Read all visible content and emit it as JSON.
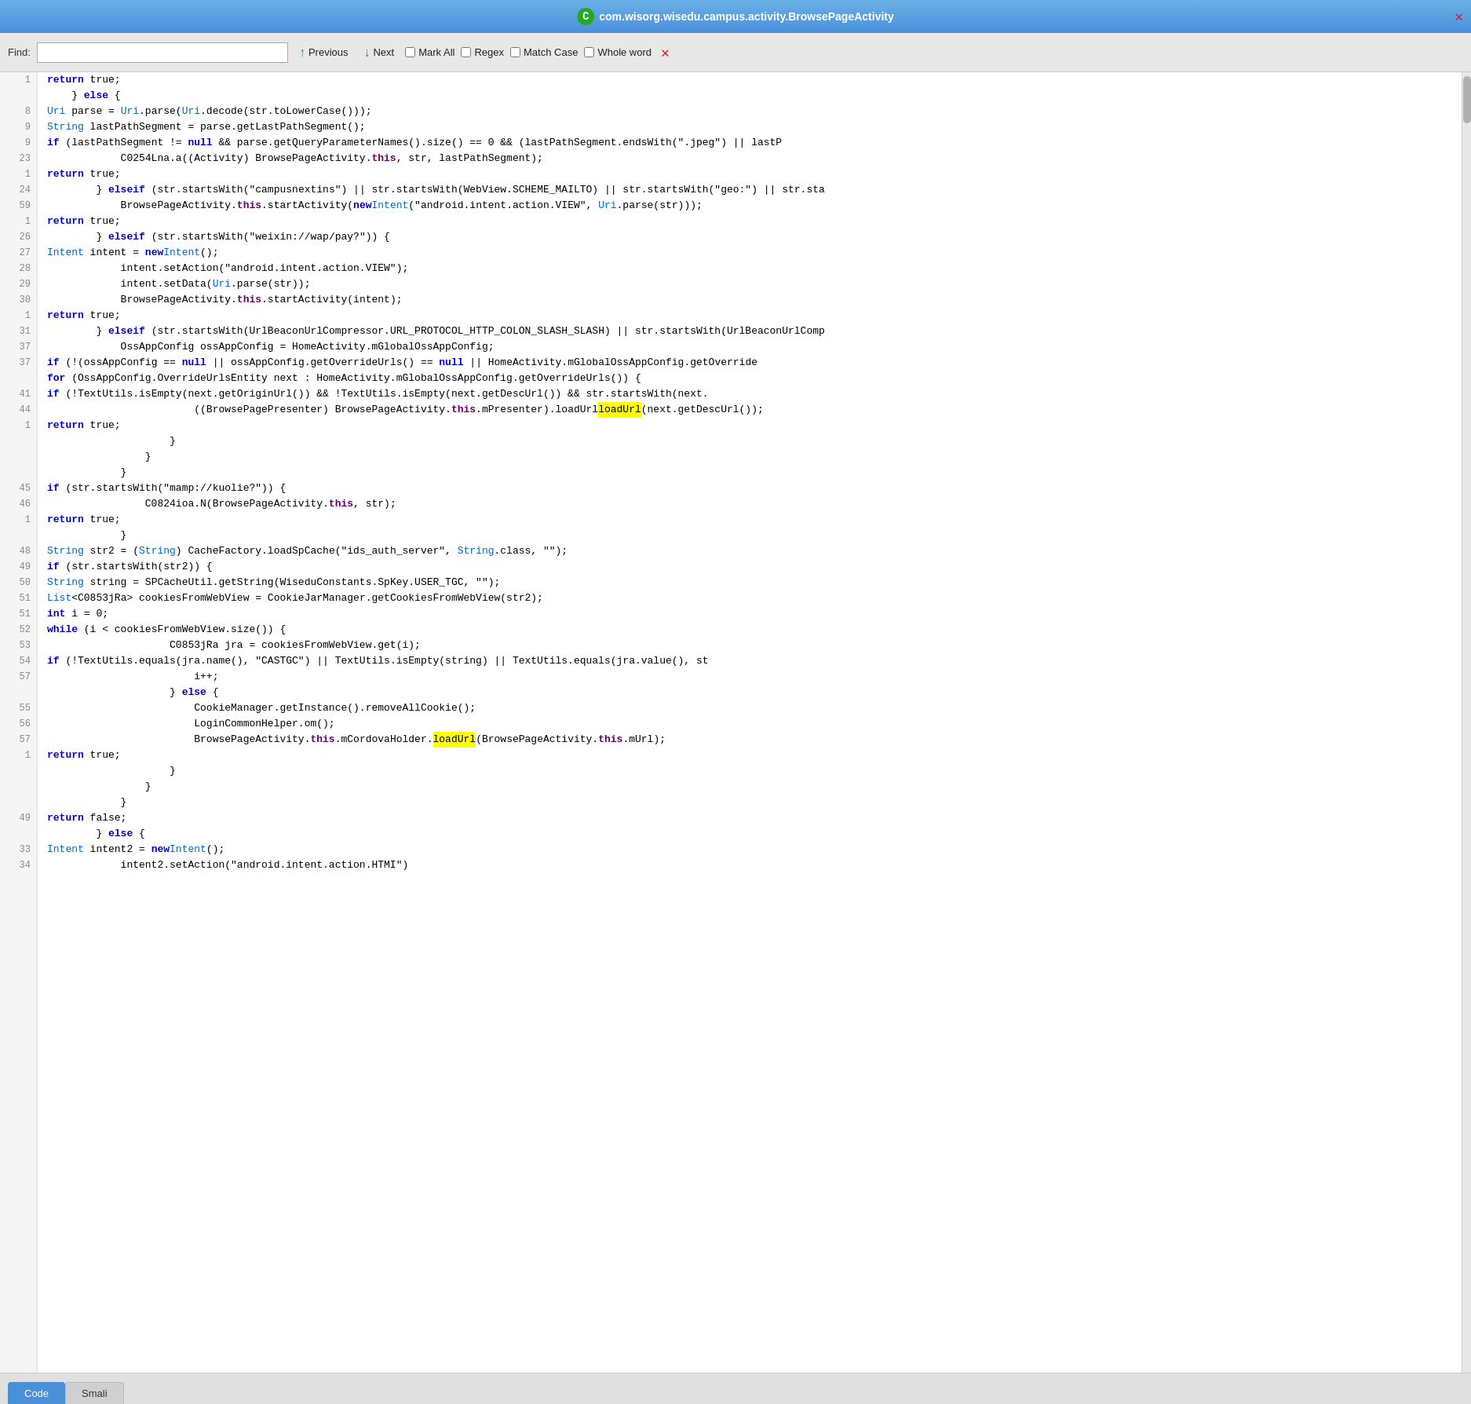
{
  "titleBar": {
    "title": "com.wisorg.wisedu.campus.activity.BrowsePageActivity",
    "icon": "C",
    "closeLabel": "✕"
  },
  "findBar": {
    "label": "Find:",
    "inputValue": "",
    "inputPlaceholder": "",
    "previousLabel": "Previous",
    "nextLabel": "Next",
    "markAllLabel": "Mark All",
    "regexLabel": "Regex",
    "matchCaseLabel": "Match Case",
    "wholeWordLabel": "Whole word",
    "closeLabel": "✕"
  },
  "bottomTabs": {
    "tabs": [
      {
        "label": "Code",
        "active": true
      },
      {
        "label": "Smali",
        "active": false
      }
    ]
  },
  "codeLines": [
    {
      "num": "1",
      "content": "        return true;",
      "type": "plain"
    },
    {
      "num": "",
      "content": "    } else {",
      "type": "plain"
    },
    {
      "num": "8",
      "content": "        Uri parse = Uri.parse(Uri.decode(str.toLowerCase()));",
      "type": "plain"
    },
    {
      "num": "9",
      "content": "        String lastPathSegment = parse.getLastPathSegment();",
      "type": "plain"
    },
    {
      "num": "9",
      "content": "        if (lastPathSegment != null && parse.getQueryParameterNames().size() == 0 && (lastPathSegment.endsWith(\".jpeg\") || lastP",
      "type": "plain"
    },
    {
      "num": "23",
      "content": "            C0254Lna.a((Activity) BrowsePageActivity.this, str, lastPathSegment);",
      "type": "plain"
    },
    {
      "num": "1",
      "content": "            return true;",
      "type": "plain"
    },
    {
      "num": "24",
      "content": "        } else if (str.startsWith(\"campusnextins\") || str.startsWith(WebView.SCHEME_MAILTO) || str.startsWith(\"geo:\") || str.sta",
      "type": "plain"
    },
    {
      "num": "59",
      "content": "            BrowsePageActivity.this.startActivity(new Intent(\"android.intent.action.VIEW\", Uri.parse(str)));",
      "type": "plain"
    },
    {
      "num": "1",
      "content": "            return true;",
      "type": "plain"
    },
    {
      "num": "26",
      "content": "        } else if (str.startsWith(\"weixin://wap/pay?\")) {",
      "type": "plain"
    },
    {
      "num": "27",
      "content": "            Intent intent = new Intent();",
      "type": "plain"
    },
    {
      "num": "28",
      "content": "            intent.setAction(\"android.intent.action.VIEW\");",
      "type": "plain"
    },
    {
      "num": "29",
      "content": "            intent.setData(Uri.parse(str));",
      "type": "plain"
    },
    {
      "num": "30",
      "content": "            BrowsePageActivity.this.startActivity(intent);",
      "type": "plain"
    },
    {
      "num": "1",
      "content": "            return true;",
      "type": "plain"
    },
    {
      "num": "31",
      "content": "        } else if (str.startsWith(UrlBeaconUrlCompressor.URL_PROTOCOL_HTTP_COLON_SLASH_SLASH) || str.startsWith(UrlBeaconUrlComp",
      "type": "plain"
    },
    {
      "num": "37",
      "content": "            OssAppConfig ossAppConfig = HomeActivity.mGlobalOssAppConfig;",
      "type": "plain"
    },
    {
      "num": "37",
      "content": "            if (!(ossAppConfig == null || ossAppConfig.getOverrideUrls() == null || HomeActivity.mGlobalOssAppConfig.getOverride",
      "type": "plain"
    },
    {
      "num": "",
      "content": "                for (OssAppConfig.OverrideUrlsEntity next : HomeActivity.mGlobalOssAppConfig.getOverrideUrls()) {",
      "type": "plain"
    },
    {
      "num": "41",
      "content": "                    if (!TextUtils.isEmpty(next.getOriginUrl()) && !TextUtils.isEmpty(next.getDescUrl()) && str.startsWith(next.",
      "type": "plain"
    },
    {
      "num": "44",
      "content": "                        ((BrowsePagePresenter) BrowsePageActivity.this.mPresenter).loadUrl(next.getDescUrl());",
      "type": "highlight"
    },
    {
      "num": "1",
      "content": "                        return true;",
      "type": "plain"
    },
    {
      "num": "",
      "content": "                    }",
      "type": "plain"
    },
    {
      "num": "",
      "content": "                }",
      "type": "plain"
    },
    {
      "num": "",
      "content": "            }",
      "type": "plain"
    },
    {
      "num": "45",
      "content": "            if (str.startsWith(\"mamp://kuolie?\")) {",
      "type": "plain"
    },
    {
      "num": "46",
      "content": "                C0824ioa.N(BrowsePageActivity.this, str);",
      "type": "plain"
    },
    {
      "num": "1",
      "content": "                return true;",
      "type": "plain"
    },
    {
      "num": "",
      "content": "            }",
      "type": "plain"
    },
    {
      "num": "48",
      "content": "            String str2 = (String) CacheFactory.loadSpCache(\"ids_auth_server\", String.class, \"\");",
      "type": "plain"
    },
    {
      "num": "49",
      "content": "            if (str.startsWith(str2)) {",
      "type": "plain"
    },
    {
      "num": "50",
      "content": "                String string = SPCacheUtil.getString(WiseduConstants.SpKey.USER_TGC, \"\");",
      "type": "plain"
    },
    {
      "num": "51",
      "content": "                List<C0853jRa> cookiesFromWebView = CookieJarManager.getCookiesFromWebView(str2);",
      "type": "plain"
    },
    {
      "num": "51",
      "content": "                int i = 0;",
      "type": "int"
    },
    {
      "num": "52",
      "content": "                while (i < cookiesFromWebView.size()) {",
      "type": "plain"
    },
    {
      "num": "53",
      "content": "                    C0853jRa jra = cookiesFromWebView.get(i);",
      "type": "plain"
    },
    {
      "num": "54",
      "content": "                    if (!TextUtils.equals(jra.name(), \"CASTGC\") || TextUtils.isEmpty(string) || TextUtils.equals(jra.value(), st",
      "type": "plain"
    },
    {
      "num": "57",
      "content": "                        i++;",
      "type": "plain"
    },
    {
      "num": "",
      "content": "                    } else {",
      "type": "plain"
    },
    {
      "num": "55",
      "content": "                        CookieManager.getInstance().removeAllCookie();",
      "type": "plain"
    },
    {
      "num": "56",
      "content": "                        LoginCommonHelper.om();",
      "type": "plain"
    },
    {
      "num": "57",
      "content": "                        BrowsePageActivity.this.mCordovaHolder.loadUrl(BrowsePageActivity.this.mUrl);",
      "type": "highlight2"
    },
    {
      "num": "1",
      "content": "                        return true;",
      "type": "plain"
    },
    {
      "num": "",
      "content": "                    }",
      "type": "plain"
    },
    {
      "num": "",
      "content": "                }",
      "type": "plain"
    },
    {
      "num": "",
      "content": "            }",
      "type": "plain"
    },
    {
      "num": "49",
      "content": "            return false;",
      "type": "plain"
    },
    {
      "num": "",
      "content": "        } else {",
      "type": "plain"
    },
    {
      "num": "33",
      "content": "            Intent intent2 = new Intent();",
      "type": "plain"
    },
    {
      "num": "34",
      "content": "            intent2.setAction(\"android.intent.action.HTMI\")",
      "type": "plain"
    }
  ]
}
